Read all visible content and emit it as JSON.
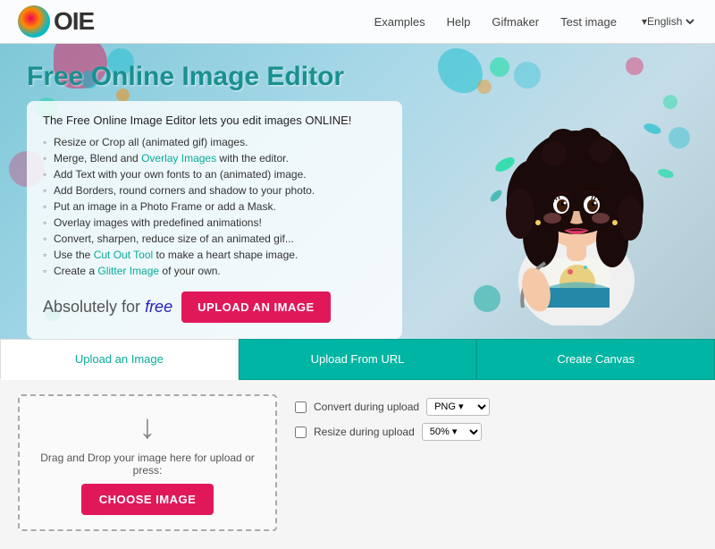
{
  "nav": {
    "logo_letters": "IE",
    "links": [
      {
        "label": "Examples",
        "id": "examples"
      },
      {
        "label": "Help",
        "id": "help"
      },
      {
        "label": "Gifmaker",
        "id": "gifmaker"
      },
      {
        "label": "Test image",
        "id": "test-image"
      }
    ],
    "language": "▾English"
  },
  "hero": {
    "title": "Free Online Image Editor",
    "intro": "The Free Online Image Editor lets you edit images ONLINE!",
    "features": [
      {
        "text": "Resize or Crop all (animated gif) images.",
        "link": null
      },
      {
        "text": "Merge, Blend and ",
        "link": "Overlay Images",
        "after": " with the editor."
      },
      {
        "text": "Add Text with your own fonts to an (animated) image.",
        "link": null
      },
      {
        "text": "Add Borders, round corners and shadow to your photo.",
        "link": null
      },
      {
        "text": "Put an image in a Photo Frame or add a Mask.",
        "link": null
      },
      {
        "text": "Overlay images with predefined animations!",
        "link": null
      },
      {
        "text": "Convert, sharpen, reduce size of an animated gif...",
        "link": null
      },
      {
        "text": "Use the ",
        "link": "Cut Out Tool",
        "after": " to make a heart shape image."
      },
      {
        "text": "Create a ",
        "link": "Glitter Image",
        "after": " of your own."
      }
    ],
    "free_prefix": "Absolutely for ",
    "free_word": "free",
    "upload_btn": "UPLOAD AN IMAGE"
  },
  "tabs": [
    {
      "label": "Upload an Image",
      "type": "white",
      "id": "upload"
    },
    {
      "label": "Upload From URL",
      "type": "teal",
      "id": "url"
    },
    {
      "label": "Create Canvas",
      "type": "teal",
      "id": "canvas"
    }
  ],
  "upload_zone": {
    "drag_text": "Drag and Drop your image here for upload or press:",
    "choose_btn": "CHOOSE IMAGE",
    "arrow_icon": "↓"
  },
  "options": {
    "convert_label": "Convert during upload",
    "convert_value": "PNG ▾",
    "resize_label": "Resize during upload",
    "resize_value": "50% ▾"
  }
}
